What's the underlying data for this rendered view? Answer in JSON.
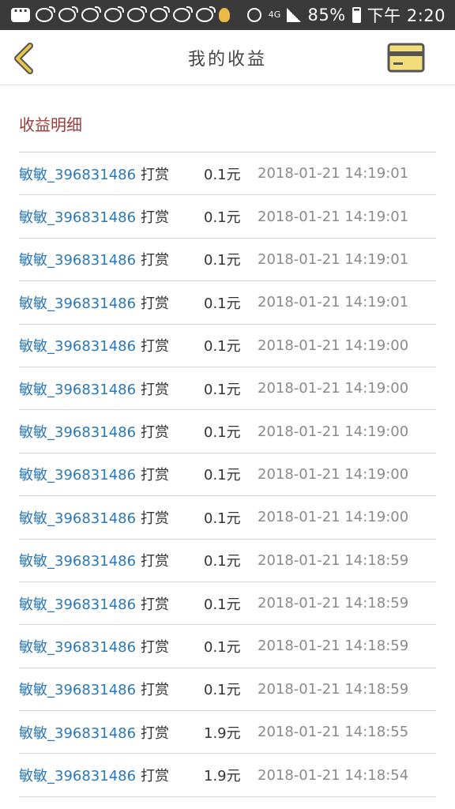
{
  "status_bar": {
    "battery_percent": "85%",
    "time": "下午 2:20",
    "network": "4G",
    "icons": [
      "chat-icon",
      "weibo-icon",
      "weibo-icon",
      "weibo-icon",
      "weibo-icon",
      "weibo-icon",
      "weibo-icon",
      "weibo-icon",
      "weibo-icon",
      "bulb-icon",
      "alarm-icon",
      "signal-icon",
      "battery-icon"
    ]
  },
  "header": {
    "title": "我的收益",
    "accent_color": "#e9c545",
    "back_icon": "chevron-left-icon",
    "card_icon": "card-icon"
  },
  "section": {
    "title": "收益明细",
    "title_color": "#9b3a3a"
  },
  "records": [
    {
      "user": "敏敏_396831486",
      "action": "打赏",
      "amount": "0.1元",
      "time": "2018-01-21 14:19:01"
    },
    {
      "user": "敏敏_396831486",
      "action": "打赏",
      "amount": "0.1元",
      "time": "2018-01-21 14:19:01"
    },
    {
      "user": "敏敏_396831486",
      "action": "打赏",
      "amount": "0.1元",
      "time": "2018-01-21 14:19:01"
    },
    {
      "user": "敏敏_396831486",
      "action": "打赏",
      "amount": "0.1元",
      "time": "2018-01-21 14:19:01"
    },
    {
      "user": "敏敏_396831486",
      "action": "打赏",
      "amount": "0.1元",
      "time": "2018-01-21 14:19:00"
    },
    {
      "user": "敏敏_396831486",
      "action": "打赏",
      "amount": "0.1元",
      "time": "2018-01-21 14:19:00"
    },
    {
      "user": "敏敏_396831486",
      "action": "打赏",
      "amount": "0.1元",
      "time": "2018-01-21 14:19:00"
    },
    {
      "user": "敏敏_396831486",
      "action": "打赏",
      "amount": "0.1元",
      "time": "2018-01-21 14:19:00"
    },
    {
      "user": "敏敏_396831486",
      "action": "打赏",
      "amount": "0.1元",
      "time": "2018-01-21 14:19:00"
    },
    {
      "user": "敏敏_396831486",
      "action": "打赏",
      "amount": "0.1元",
      "time": "2018-01-21 14:18:59"
    },
    {
      "user": "敏敏_396831486",
      "action": "打赏",
      "amount": "0.1元",
      "time": "2018-01-21 14:18:59"
    },
    {
      "user": "敏敏_396831486",
      "action": "打赏",
      "amount": "0.1元",
      "time": "2018-01-21 14:18:59"
    },
    {
      "user": "敏敏_396831486",
      "action": "打赏",
      "amount": "0.1元",
      "time": "2018-01-21 14:18:59"
    },
    {
      "user": "敏敏_396831486",
      "action": "打赏",
      "amount": "1.9元",
      "time": "2018-01-21 14:18:55"
    },
    {
      "user": "敏敏_396831486",
      "action": "打赏",
      "amount": "1.9元",
      "time": "2018-01-21 14:18:54"
    }
  ]
}
